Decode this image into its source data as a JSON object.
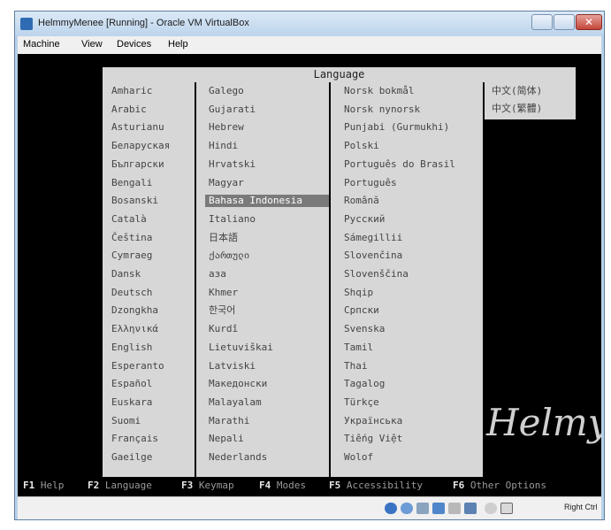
{
  "window": {
    "title": "HelmmyMenee [Running] - Oracle VM VirtualBox",
    "close_symbol": "✕"
  },
  "menubar": {
    "items": [
      "Machine",
      "View",
      "Devices",
      "Help"
    ]
  },
  "language_menu": {
    "header": "Language",
    "columns": [
      [
        "Amharic",
        "Arabic",
        "Asturianu",
        "Беларуская",
        "Български",
        "Bengali",
        "Bosanski",
        "Català",
        "Čeština",
        "Cymraeg",
        "Dansk",
        "Deutsch",
        "Dzongkha",
        "Ελληνικά",
        "English",
        "Esperanto",
        "Español",
        "Euskara",
        "Suomi",
        "Français",
        "Gaeilge"
      ],
      [
        "Galego",
        "Gujarati",
        "Hebrew",
        "Hindi",
        "Hrvatski",
        "Magyar",
        "Bahasa Indonesia",
        "Italiano",
        "日本語",
        "ქართული",
        "аза",
        "Khmer",
        "한국어",
        "Kurdî",
        "Lietuviškai",
        "Latviski",
        "Македонски",
        "Malayalam",
        "Marathi",
        "Nepali",
        "Nederlands"
      ],
      [
        "Norsk bokmål",
        "Norsk nynorsk",
        "Punjabi (Gurmukhi)",
        "Polski",
        "Português do Brasil",
        "Português",
        "Română",
        "Русский",
        "Sámegillii",
        "Slovenčina",
        "Slovenščina",
        "Shqip",
        "Српски",
        "Svenska",
        "Tamil",
        "Thai",
        "Tagalog",
        "Türkçe",
        "Українська",
        "Tiếng Việt",
        "Wolof"
      ],
      [
        "中文(简体)",
        "中文(繁體)"
      ]
    ],
    "selected": "Bahasa Indonesia"
  },
  "function_keys": [
    {
      "key": "F1",
      "label": "Help"
    },
    {
      "key": "F2",
      "label": "Language"
    },
    {
      "key": "F3",
      "label": "Keymap"
    },
    {
      "key": "F4",
      "label": "Modes"
    },
    {
      "key": "F5",
      "label": "Accessibility"
    },
    {
      "key": "F6",
      "label": "Other Options"
    }
  ],
  "watermark": "Helmy",
  "statusbar": {
    "host_key": "Right Ctrl",
    "icons": [
      "hard-disk-icon",
      "optical-drive-icon",
      "usb-icon",
      "network-icon",
      "shared-folder-icon",
      "display-icon",
      "mouse-integration-icon",
      "keyboard-icon"
    ]
  },
  "colors": {
    "console_bg": "#000000",
    "menu_bg": "#d7d7d7",
    "selected_bg": "#7a7a7a",
    "accent": "#c5463a"
  }
}
